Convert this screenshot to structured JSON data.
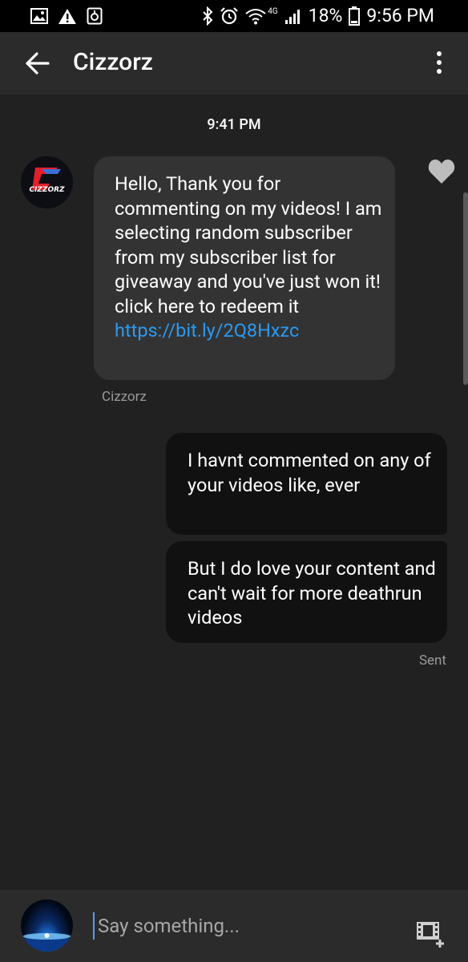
{
  "status_bar": {
    "battery": "18%",
    "time": "9:56 PM",
    "network_badge": "4G",
    "left_icons": [
      "image-icon",
      "warning-icon",
      "screenshot-icon"
    ],
    "right_icons": [
      "bluetooth-icon",
      "alarm-icon",
      "wifi-icon",
      "signal-icon",
      "battery-icon"
    ]
  },
  "header": {
    "title": "Cizzorz",
    "back_icon": "arrow-left-icon",
    "menu_icon": "more-vertical-icon"
  },
  "conversation": {
    "timestamp": "9:41 PM",
    "incoming": {
      "avatar_text": "CIZZORZ",
      "text": "Hello, Thank you for commenting on my videos! I am selecting random subscriber from my subscriber list for giveaway and you've just won it! click here to redeem it ",
      "link": "https://bit.ly/2Q8Hxzc",
      "sender": "Cizzorz",
      "reaction_icon": "heart-icon"
    },
    "outgoing": [
      {
        "text": "I havnt commented on any of your videos like, ever"
      },
      {
        "text": "But I do love your content and can't wait for more deathrun videos"
      }
    ],
    "status": "Sent"
  },
  "composer": {
    "placeholder": "Say something...",
    "media_icon": "film-add-icon"
  },
  "colors": {
    "background": "#212121",
    "bar": "#2b2b2b",
    "incoming_bubble": "#333333",
    "outgoing_bubble": "#111111",
    "link": "#2a9af2"
  }
}
